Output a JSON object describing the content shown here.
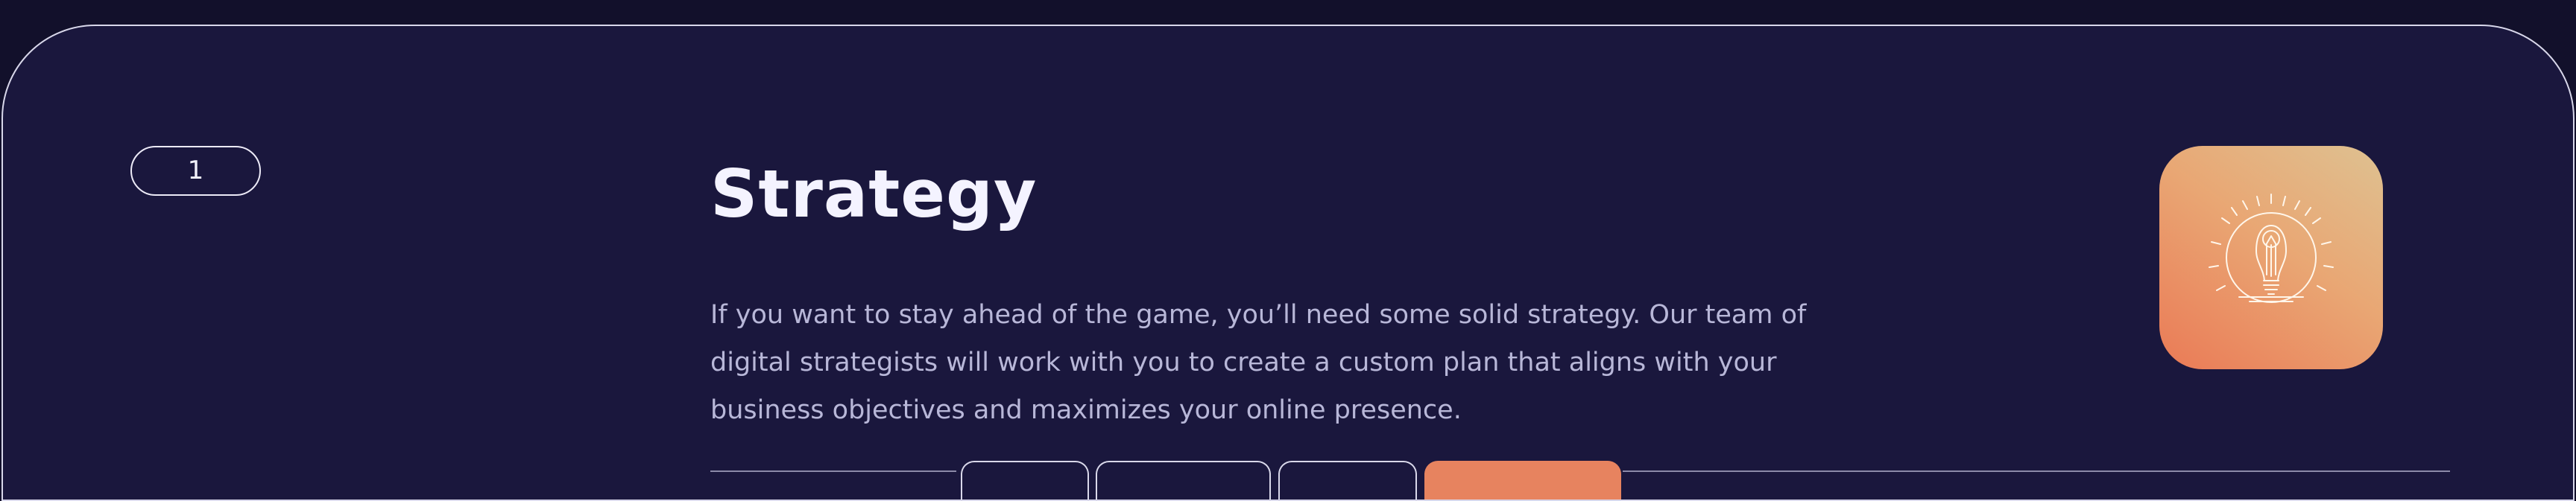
{
  "service": {
    "number": "1",
    "title": "Strategy",
    "description": "If you want to stay ahead of the game, you’ll need some solid strategy. Our team of digital strategists will work with you to create a custom plan that aligns with your business objectives and maximizes your online presence.",
    "icon": "lightbulb-icon"
  },
  "colors": {
    "background": "#12102b",
    "card": "#1a173d",
    "accent": "#e7835f"
  }
}
